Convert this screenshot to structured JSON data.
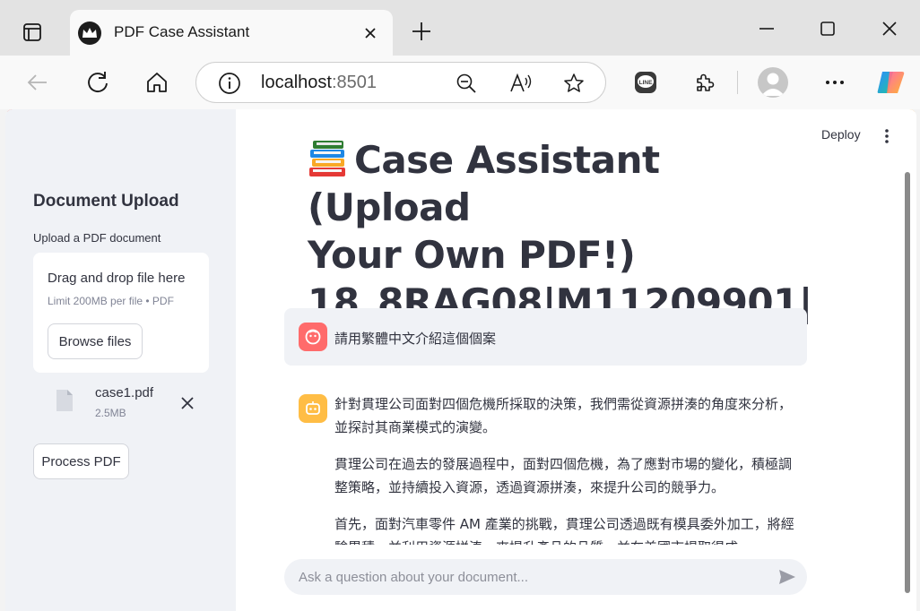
{
  "browser": {
    "tab": {
      "title": "PDF Case Assistant"
    },
    "address": {
      "host": "localhost",
      "port": ":8501"
    }
  },
  "app": {
    "header": {
      "deploy_label": "Deploy"
    },
    "sidebar": {
      "title": "Document Upload",
      "uploader_label": "Upload a PDF document",
      "dropzone_title": "Drag and drop file here",
      "dropzone_limit": "Limit 200MB per file • PDF",
      "browse_label": "Browse files",
      "file": {
        "name": "case1.pdf",
        "size": "2.5MB"
      },
      "process_label": "Process PDF"
    },
    "main": {
      "title_line1": "Case Assistant (Upload",
      "title_line2": "Your Own PDF!)",
      "title_line3": "18_8RAG08|M11209901|",
      "user_message": "請用繁體中文介紹這個個案",
      "assistant_paragraphs": [
        "針對貫理公司面對四個危機所採取的決策，我們需從資源拼湊的角度來分析，並探討其商業模式的演變。",
        "貫理公司在過去的發展過程中，面對四個危機，為了應對市場的變化，積極調整策略，並持續投入資源，透過資源拼湊，來提升公司的競爭力。",
        "首先，面對汽車零件 AM 產業的挑戰，貫理公司透過既有模具委外加工，將經驗累積，並利用資源拼湊，來提升產品的品質，並在美國市場取得成"
      ],
      "chat_placeholder": "Ask a question about your document..."
    }
  },
  "colors": {
    "accent_red": "#ff4b4b",
    "accent_orange": "#ffbd45",
    "sidebar_bg": "#f0f2f6"
  },
  "icons": [
    "tab-actions-icon",
    "crown-favicon",
    "close-icon",
    "plus-icon",
    "minimize-icon",
    "maximize-icon",
    "back-icon",
    "reload-icon",
    "home-icon",
    "info-icon",
    "zoom-out-icon",
    "read-aloud-icon",
    "star-icon",
    "line-extension-icon",
    "extensions-icon",
    "profile-icon",
    "more-icon",
    "copilot-icon",
    "kebab-menu-icon",
    "file-icon",
    "books-emoji-icon",
    "user-avatar-icon",
    "assistant-avatar-icon",
    "send-icon"
  ]
}
